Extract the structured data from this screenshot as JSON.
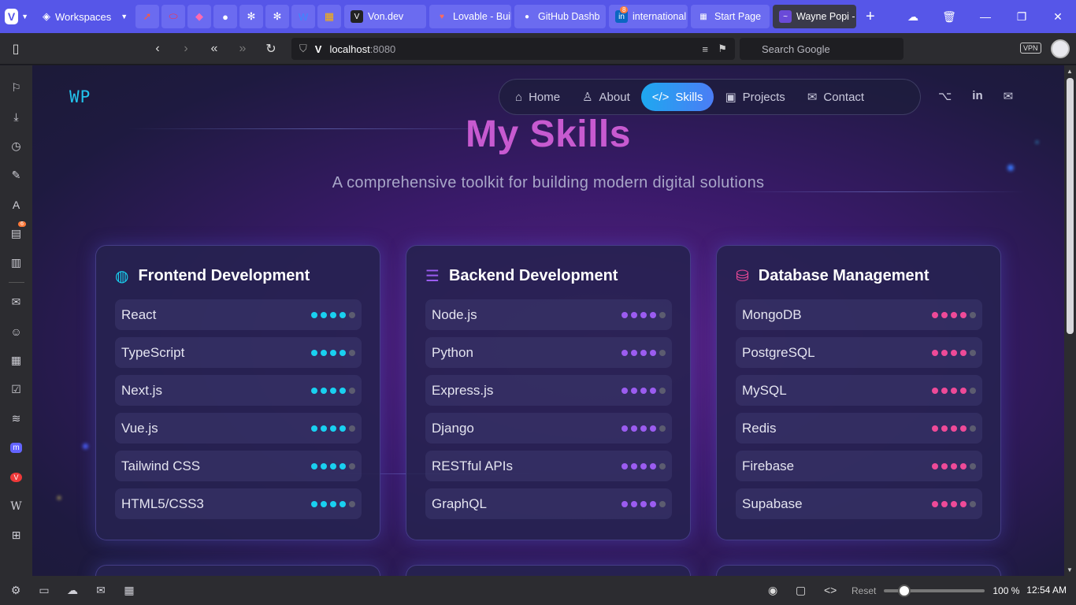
{
  "browser": {
    "workspaces_label": "Workspaces",
    "tabs": [
      {
        "label": "Von.dev",
        "icon": "v-logo-icon"
      },
      {
        "label": "Lovable - Buil",
        "icon": "lovable-icon"
      },
      {
        "label": "GitHub Dashb",
        "icon": "github-icon"
      },
      {
        "label": "international s",
        "icon": "linkedin-icon",
        "badge": "8"
      },
      {
        "label": "Start Page",
        "icon": "grid-icon"
      },
      {
        "label": "Wayne Popi -",
        "icon": "portfolio-icon",
        "active": true
      }
    ],
    "url_host": "localhost",
    "url_port": ":8080",
    "search_placeholder": "Search Google",
    "vpn_label": "VPN",
    "sidebar_badge": "6"
  },
  "status": {
    "reset_label": "Reset",
    "zoom": "100 %",
    "time": "12:54 AM"
  },
  "site": {
    "logo": "WP",
    "nav": [
      {
        "label": "Home",
        "icon": "home-icon"
      },
      {
        "label": "About",
        "icon": "user-icon"
      },
      {
        "label": "Skills",
        "icon": "code-icon",
        "active": true
      },
      {
        "label": "Projects",
        "icon": "briefcase-icon"
      },
      {
        "label": "Contact",
        "icon": "mail-icon"
      }
    ],
    "title": "My Skills",
    "subtitle": "A comprehensive toolkit for building modern digital solutions",
    "colors": {
      "frontend": "#19d0f0",
      "backend": "#9b5cf0",
      "database": "#ee4a98",
      "empty": "#5c5c70"
    },
    "categories": [
      {
        "title": "Frontend Development",
        "icon": "globe-icon",
        "skills": [
          {
            "name": "React",
            "level": 4,
            "max": 5
          },
          {
            "name": "TypeScript",
            "level": 4,
            "max": 5
          },
          {
            "name": "Next.js",
            "level": 4,
            "max": 5
          },
          {
            "name": "Vue.js",
            "level": 4,
            "max": 5
          },
          {
            "name": "Tailwind CSS",
            "level": 4,
            "max": 5
          },
          {
            "name": "HTML5/CSS3",
            "level": 4,
            "max": 5
          }
        ]
      },
      {
        "title": "Backend Development",
        "icon": "server-icon",
        "skills": [
          {
            "name": "Node.js",
            "level": 4,
            "max": 5
          },
          {
            "name": "Python",
            "level": 4,
            "max": 5
          },
          {
            "name": "Express.js",
            "level": 4,
            "max": 5
          },
          {
            "name": "Django",
            "level": 4,
            "max": 5
          },
          {
            "name": "RESTful APIs",
            "level": 4,
            "max": 5
          },
          {
            "name": "GraphQL",
            "level": 4,
            "max": 5
          }
        ]
      },
      {
        "title": "Database Management",
        "icon": "database-icon",
        "skills": [
          {
            "name": "MongoDB",
            "level": 4,
            "max": 5
          },
          {
            "name": "PostgreSQL",
            "level": 4,
            "max": 5
          },
          {
            "name": "MySQL",
            "level": 4,
            "max": 5
          },
          {
            "name": "Redis",
            "level": 4,
            "max": 5
          },
          {
            "name": "Firebase",
            "level": 4,
            "max": 5
          },
          {
            "name": "Supabase",
            "level": 4,
            "max": 5
          }
        ]
      }
    ]
  }
}
